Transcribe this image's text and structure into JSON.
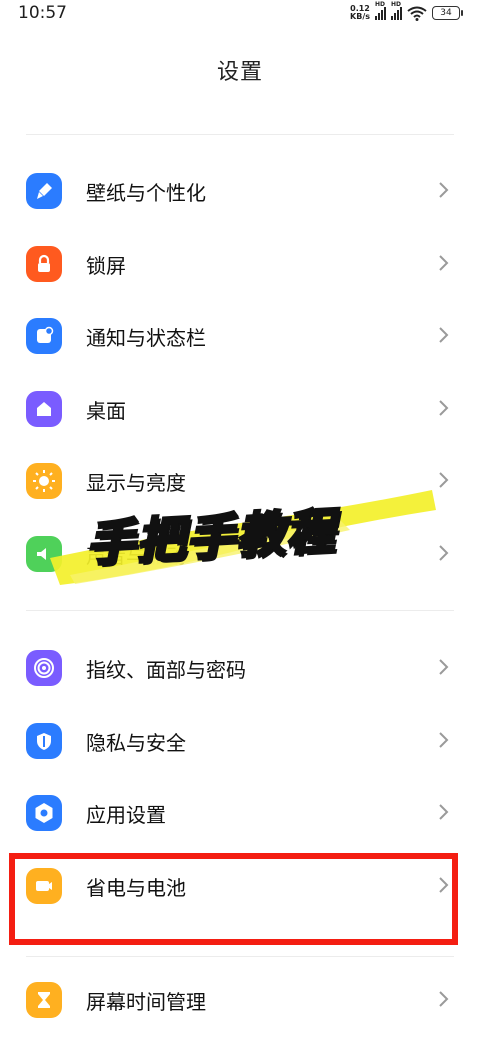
{
  "status": {
    "time": "10:57",
    "net_value": "0.12",
    "net_unit": "KB/s",
    "hd1": "HD",
    "hd2": "HD",
    "battery": "34"
  },
  "header": {
    "title": "设置"
  },
  "items": [
    {
      "label": "壁纸与个性化",
      "icon": "brush-icon",
      "color": "#2b7cff"
    },
    {
      "label": "锁屏",
      "icon": "lock-icon",
      "color": "#ff5a1f"
    },
    {
      "label": "通知与状态栏",
      "icon": "notification-icon",
      "color": "#2b7cff"
    },
    {
      "label": "桌面",
      "icon": "home-icon",
      "color": "#7a5cff"
    },
    {
      "label": "显示与亮度",
      "icon": "sun-icon",
      "color": "#ffb020"
    },
    {
      "label": "声音与振动",
      "icon": "sound-icon",
      "color": "#4fd15a"
    },
    {
      "label": "指纹、面部与密码",
      "icon": "fingerprint-icon",
      "color": "#7a5cff"
    },
    {
      "label": "隐私与安全",
      "icon": "shield-icon",
      "color": "#2b7cff"
    },
    {
      "label": "应用设置",
      "icon": "gear-icon",
      "color": "#2b7cff"
    },
    {
      "label": "省电与电池",
      "icon": "battery-icon",
      "color": "#ffb020"
    },
    {
      "label": "屏幕时间管理",
      "icon": "hourglass-icon",
      "color": "#ffb020"
    }
  ],
  "overlay": {
    "text": "手把手教程"
  },
  "colors": {
    "highlight_box": "#f41e12",
    "brush_stroke": "#f3f02a"
  }
}
